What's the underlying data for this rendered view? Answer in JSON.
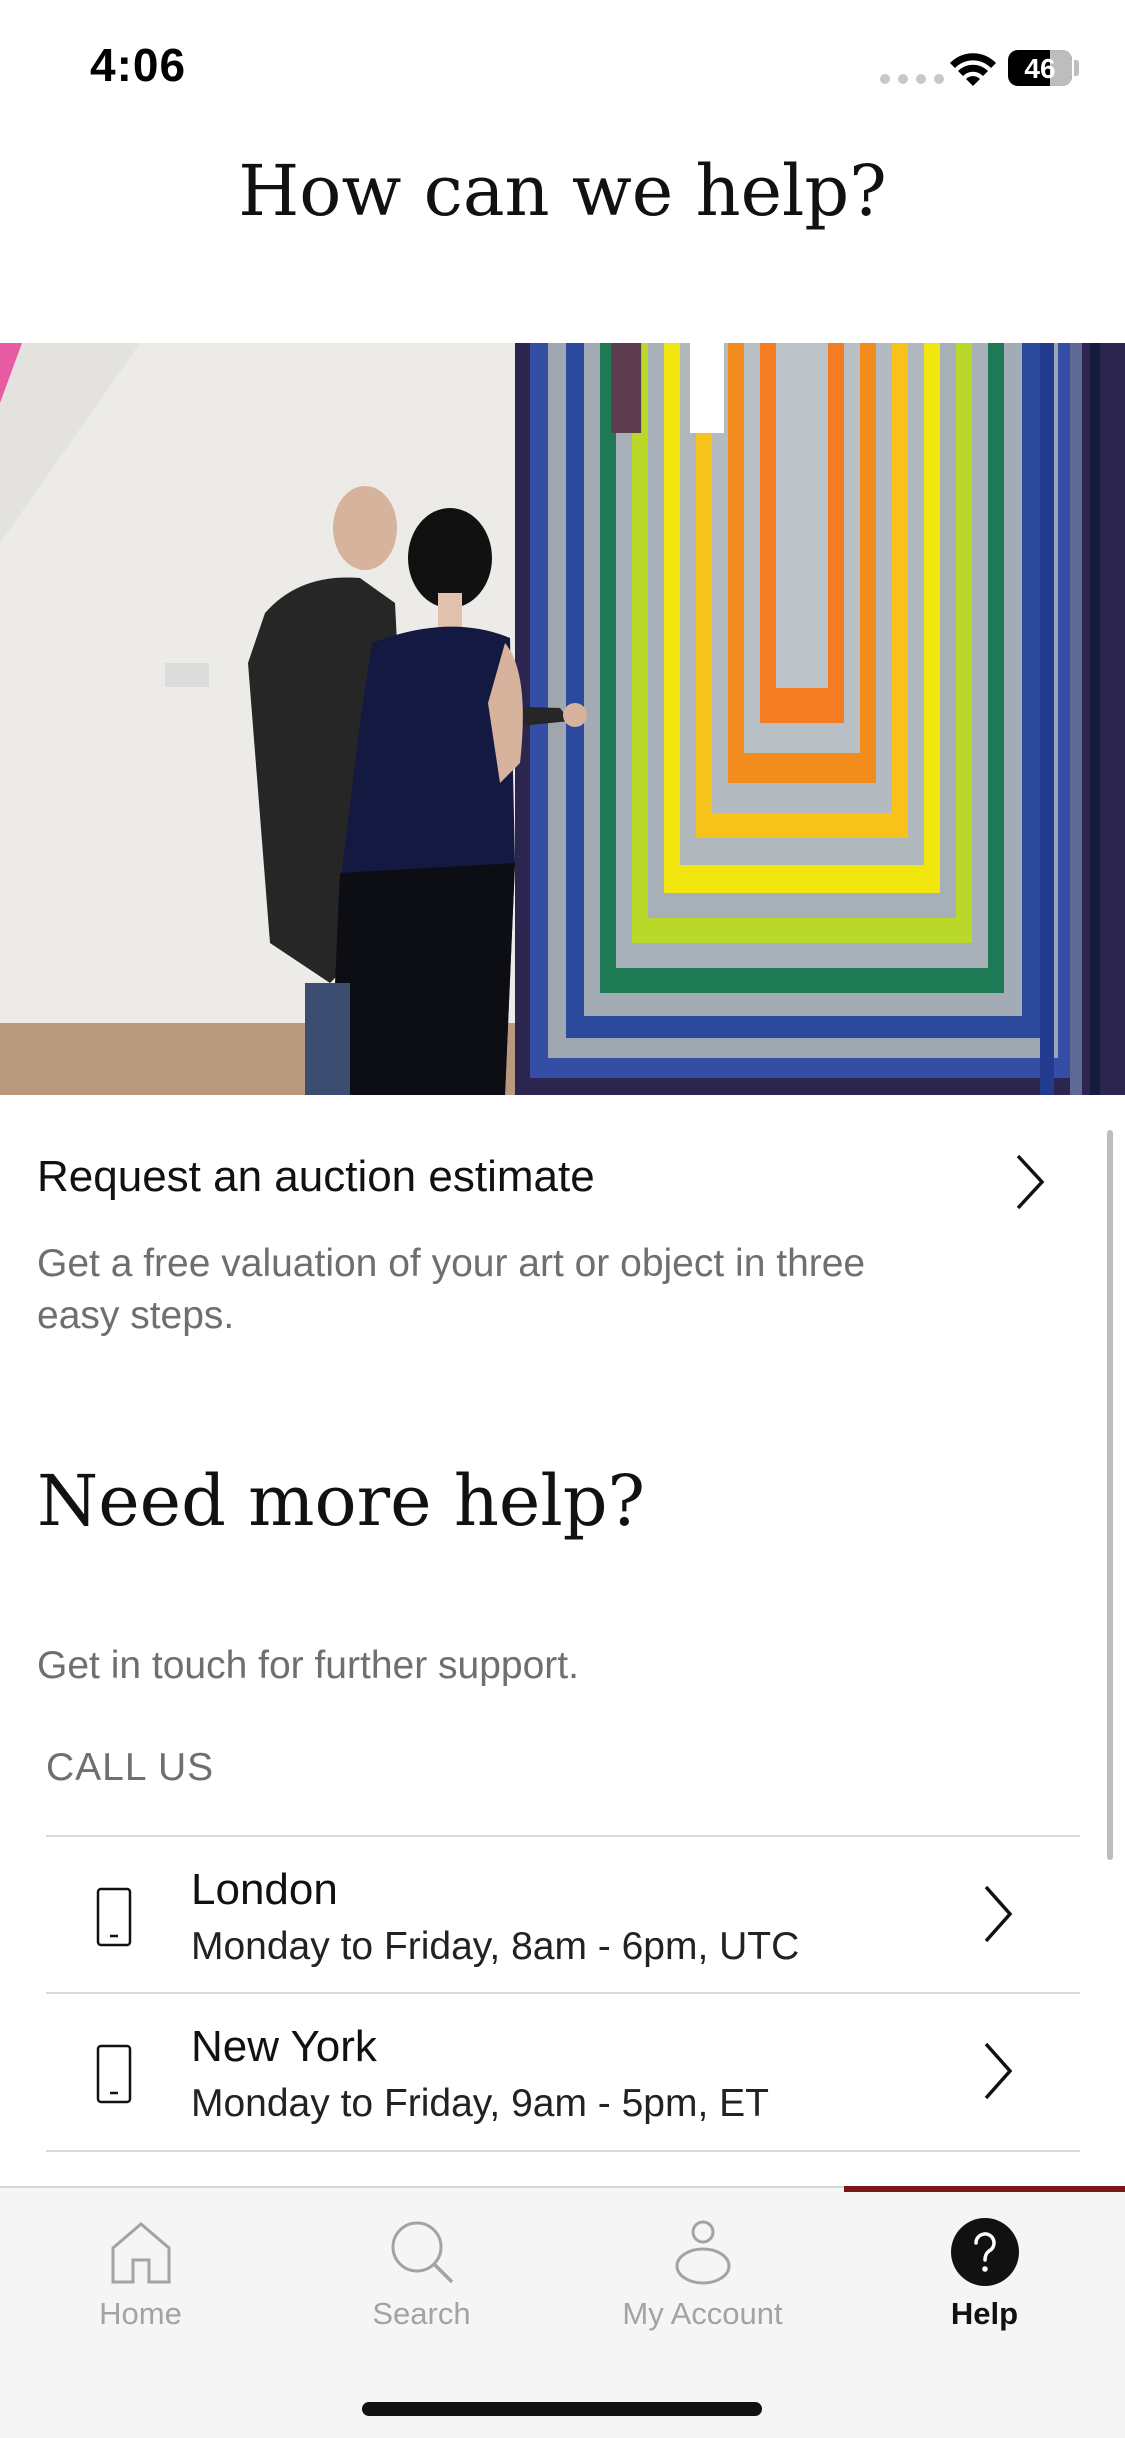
{
  "status_bar": {
    "time": "4:06",
    "battery": "46"
  },
  "page": {
    "title": "How can we help?"
  },
  "estimate": {
    "title": "Request an auction estimate",
    "description": "Get a free valuation of your art or object in three easy steps."
  },
  "help": {
    "heading": "Need more help?",
    "subtitle": "Get in touch for further support.",
    "call_label": "CALL US",
    "locations": [
      {
        "city": "London",
        "hours": "Monday to Friday, 8am - 6pm, UTC"
      },
      {
        "city": "New York",
        "hours": "Monday to Friday, 9am - 5pm, ET"
      }
    ]
  },
  "tabs": [
    {
      "label": "Home",
      "icon": "home-icon",
      "active": false
    },
    {
      "label": "Search",
      "icon": "search-icon",
      "active": false
    },
    {
      "label": "My Account",
      "icon": "account-icon",
      "active": false
    },
    {
      "label": "Help",
      "icon": "help-icon",
      "active": true
    }
  ],
  "colors": {
    "accent": "#7a1518",
    "muted_text": "#6f6f6f",
    "tab_inactive": "#a3a3a3"
  }
}
